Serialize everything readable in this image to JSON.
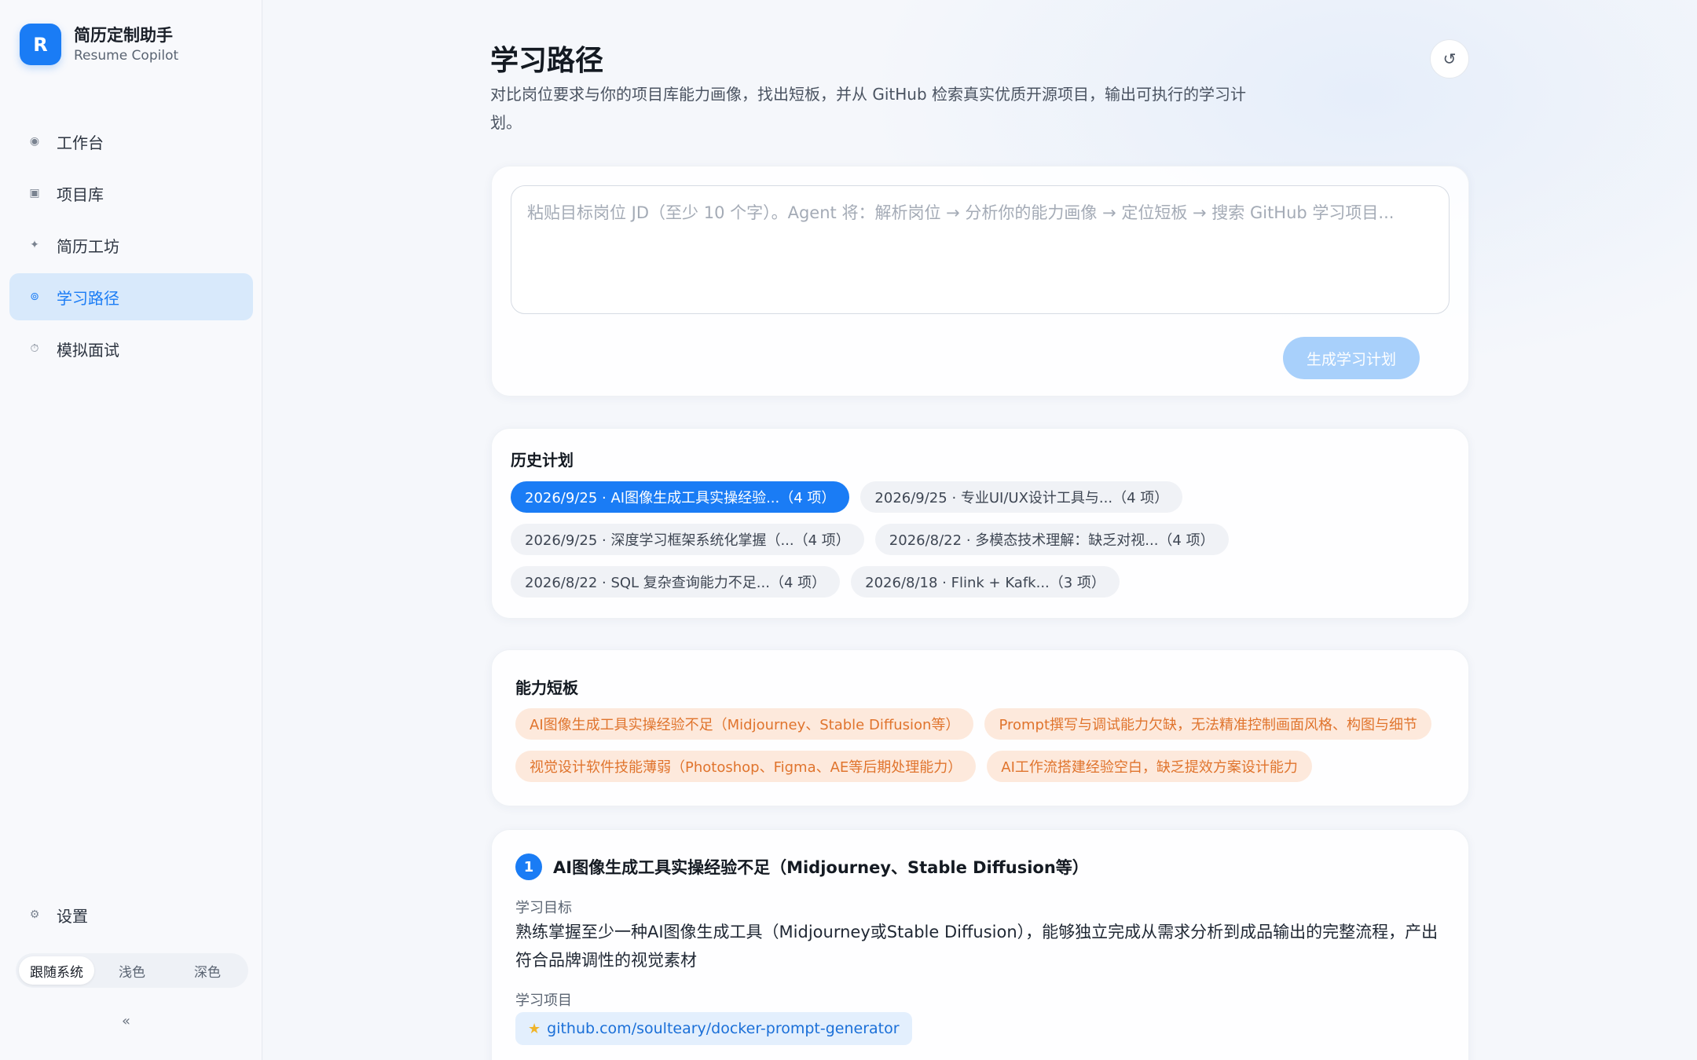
{
  "brand": {
    "logo": "R",
    "title": "简历定制助手",
    "subtitle": "Resume Copilot"
  },
  "nav": [
    {
      "icon": "◉",
      "label": "工作台",
      "active": false
    },
    {
      "icon": "▣",
      "label": "项目库",
      "active": false
    },
    {
      "icon": "✦",
      "label": "简历工坊",
      "active": false
    },
    {
      "icon": "⊚",
      "label": "学习路径",
      "active": true
    },
    {
      "icon": "⏱",
      "label": "模拟面试",
      "active": false
    }
  ],
  "settings": {
    "icon": "⚙",
    "label": "设置"
  },
  "theme": {
    "options": [
      "跟随系统",
      "浅色",
      "深色"
    ],
    "selected": "跟随系统"
  },
  "collapse_label": "«",
  "header": {
    "title": "学习路径",
    "description": "对比岗位要求与你的项目库能力画像，找出短板，并从 GitHub 检索真实优质开源项目，输出可执行的学习计划。",
    "refresh_icon": "↺"
  },
  "jd": {
    "placeholder": "粘贴目标岗位 JD（至少 10 个字）。Agent 将：解析岗位 → 分析你的能力画像 → 定位短板 → 搜索 GitHub 学习项目...",
    "value": "",
    "generate_label": "生成学习计划"
  },
  "history": {
    "title": "历史计划",
    "rows": [
      [
        "2026/9/25 · AI图像生成工具实操经验...（4 项）",
        "2026/9/25 · 专业UI/UX设计工具与...（4 项）"
      ],
      [
        "2026/9/25 · 深度学习框架系统化掌握（...（4 项）",
        "2026/8/22 · 多模态技术理解：缺乏对视...（4 项）"
      ],
      [
        "2026/8/22 · SQL 复杂查询能力不足...（4 项）",
        "2026/8/18 · Flink + Kafk...（3 项）"
      ]
    ],
    "selected": "2026/9/25 · AI图像生成工具实操经验...（4 项）"
  },
  "gaps": {
    "title": "能力短板",
    "rows": [
      [
        "AI图像生成工具实操经验不足（Midjourney、Stable Diffusion等）",
        "Prompt撰写与调试能力欠缺，无法精准控制画面风格、构图与细节"
      ],
      [
        "视觉设计软件技能薄弱（Photoshop、Figma、AE等后期处理能力）",
        "AI工作流搭建经验空白，缺乏提效方案设计能力"
      ]
    ]
  },
  "plan": {
    "number": "1",
    "title": "AI图像生成工具实操经验不足（Midjourney、Stable Diffusion等）",
    "goal_label": "学习目标",
    "goal": "熟练掌握至少一种AI图像生成工具（Midjourney或Stable Diffusion），能够独立完成从需求分析到成品输出的完整流程，产出符合品牌调性的视觉素材",
    "projects_label": "学习项目",
    "repo": "github.com/soulteary/docker-prompt-generator",
    "repo_icon": "★"
  }
}
